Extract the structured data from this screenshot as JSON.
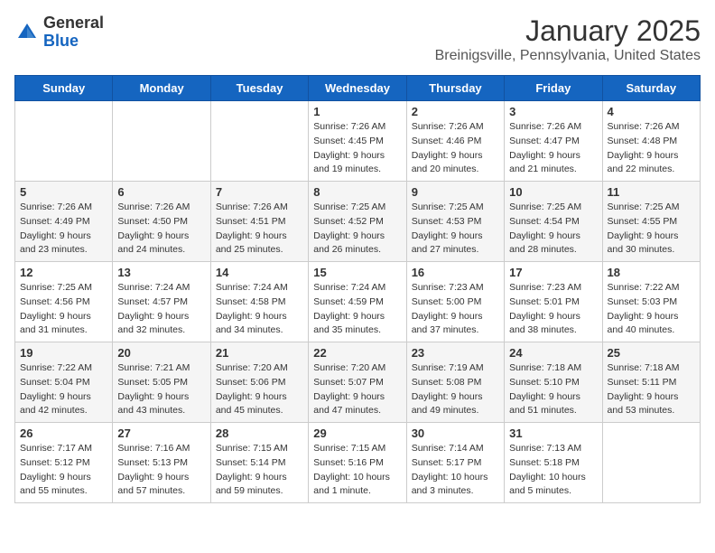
{
  "logo": {
    "general": "General",
    "blue": "Blue"
  },
  "title": "January 2025",
  "subtitle": "Breinigsville, Pennsylvania, United States",
  "days_of_week": [
    "Sunday",
    "Monday",
    "Tuesday",
    "Wednesday",
    "Thursday",
    "Friday",
    "Saturday"
  ],
  "weeks": [
    [
      {
        "day": "",
        "info": ""
      },
      {
        "day": "",
        "info": ""
      },
      {
        "day": "",
        "info": ""
      },
      {
        "day": "1",
        "info": "Sunrise: 7:26 AM\nSunset: 4:45 PM\nDaylight: 9 hours\nand 19 minutes."
      },
      {
        "day": "2",
        "info": "Sunrise: 7:26 AM\nSunset: 4:46 PM\nDaylight: 9 hours\nand 20 minutes."
      },
      {
        "day": "3",
        "info": "Sunrise: 7:26 AM\nSunset: 4:47 PM\nDaylight: 9 hours\nand 21 minutes."
      },
      {
        "day": "4",
        "info": "Sunrise: 7:26 AM\nSunset: 4:48 PM\nDaylight: 9 hours\nand 22 minutes."
      }
    ],
    [
      {
        "day": "5",
        "info": "Sunrise: 7:26 AM\nSunset: 4:49 PM\nDaylight: 9 hours\nand 23 minutes."
      },
      {
        "day": "6",
        "info": "Sunrise: 7:26 AM\nSunset: 4:50 PM\nDaylight: 9 hours\nand 24 minutes."
      },
      {
        "day": "7",
        "info": "Sunrise: 7:26 AM\nSunset: 4:51 PM\nDaylight: 9 hours\nand 25 minutes."
      },
      {
        "day": "8",
        "info": "Sunrise: 7:25 AM\nSunset: 4:52 PM\nDaylight: 9 hours\nand 26 minutes."
      },
      {
        "day": "9",
        "info": "Sunrise: 7:25 AM\nSunset: 4:53 PM\nDaylight: 9 hours\nand 27 minutes."
      },
      {
        "day": "10",
        "info": "Sunrise: 7:25 AM\nSunset: 4:54 PM\nDaylight: 9 hours\nand 28 minutes."
      },
      {
        "day": "11",
        "info": "Sunrise: 7:25 AM\nSunset: 4:55 PM\nDaylight: 9 hours\nand 30 minutes."
      }
    ],
    [
      {
        "day": "12",
        "info": "Sunrise: 7:25 AM\nSunset: 4:56 PM\nDaylight: 9 hours\nand 31 minutes."
      },
      {
        "day": "13",
        "info": "Sunrise: 7:24 AM\nSunset: 4:57 PM\nDaylight: 9 hours\nand 32 minutes."
      },
      {
        "day": "14",
        "info": "Sunrise: 7:24 AM\nSunset: 4:58 PM\nDaylight: 9 hours\nand 34 minutes."
      },
      {
        "day": "15",
        "info": "Sunrise: 7:24 AM\nSunset: 4:59 PM\nDaylight: 9 hours\nand 35 minutes."
      },
      {
        "day": "16",
        "info": "Sunrise: 7:23 AM\nSunset: 5:00 PM\nDaylight: 9 hours\nand 37 minutes."
      },
      {
        "day": "17",
        "info": "Sunrise: 7:23 AM\nSunset: 5:01 PM\nDaylight: 9 hours\nand 38 minutes."
      },
      {
        "day": "18",
        "info": "Sunrise: 7:22 AM\nSunset: 5:03 PM\nDaylight: 9 hours\nand 40 minutes."
      }
    ],
    [
      {
        "day": "19",
        "info": "Sunrise: 7:22 AM\nSunset: 5:04 PM\nDaylight: 9 hours\nand 42 minutes."
      },
      {
        "day": "20",
        "info": "Sunrise: 7:21 AM\nSunset: 5:05 PM\nDaylight: 9 hours\nand 43 minutes."
      },
      {
        "day": "21",
        "info": "Sunrise: 7:20 AM\nSunset: 5:06 PM\nDaylight: 9 hours\nand 45 minutes."
      },
      {
        "day": "22",
        "info": "Sunrise: 7:20 AM\nSunset: 5:07 PM\nDaylight: 9 hours\nand 47 minutes."
      },
      {
        "day": "23",
        "info": "Sunrise: 7:19 AM\nSunset: 5:08 PM\nDaylight: 9 hours\nand 49 minutes."
      },
      {
        "day": "24",
        "info": "Sunrise: 7:18 AM\nSunset: 5:10 PM\nDaylight: 9 hours\nand 51 minutes."
      },
      {
        "day": "25",
        "info": "Sunrise: 7:18 AM\nSunset: 5:11 PM\nDaylight: 9 hours\nand 53 minutes."
      }
    ],
    [
      {
        "day": "26",
        "info": "Sunrise: 7:17 AM\nSunset: 5:12 PM\nDaylight: 9 hours\nand 55 minutes."
      },
      {
        "day": "27",
        "info": "Sunrise: 7:16 AM\nSunset: 5:13 PM\nDaylight: 9 hours\nand 57 minutes."
      },
      {
        "day": "28",
        "info": "Sunrise: 7:15 AM\nSunset: 5:14 PM\nDaylight: 9 hours\nand 59 minutes."
      },
      {
        "day": "29",
        "info": "Sunrise: 7:15 AM\nSunset: 5:16 PM\nDaylight: 10 hours\nand 1 minute."
      },
      {
        "day": "30",
        "info": "Sunrise: 7:14 AM\nSunset: 5:17 PM\nDaylight: 10 hours\nand 3 minutes."
      },
      {
        "day": "31",
        "info": "Sunrise: 7:13 AM\nSunset: 5:18 PM\nDaylight: 10 hours\nand 5 minutes."
      },
      {
        "day": "",
        "info": ""
      }
    ]
  ]
}
